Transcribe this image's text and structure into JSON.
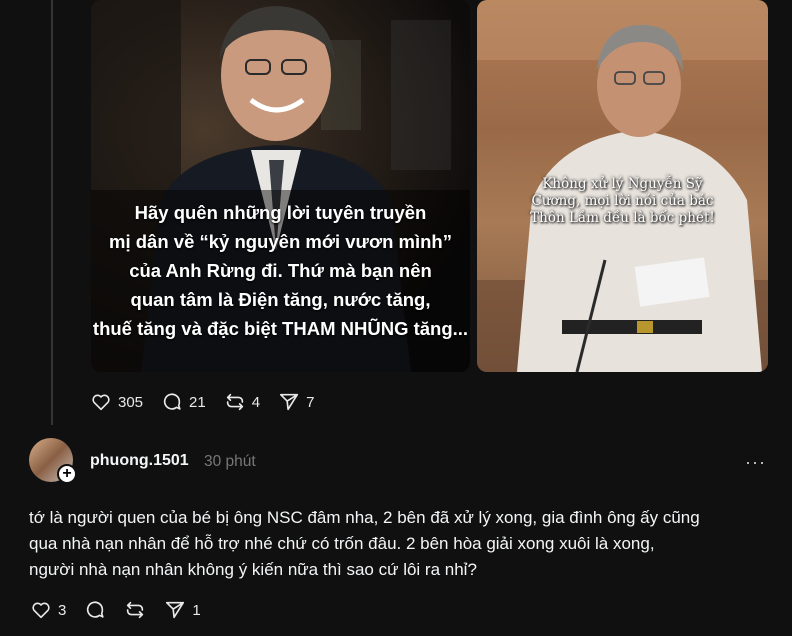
{
  "post": {
    "image1_caption_lines": [
      "Hãy quên những lời tuyên truyền",
      "mị dân về “kỷ nguyên mới vươn mình”",
      "của Anh Rừng đi. Thứ mà bạn nên",
      "quan tâm là  Điện tăng, nước tăng,",
      "thuế tăng và đặc biệt THAM NHŨNG tăng..."
    ],
    "image2_caption_lines": [
      "Không xử lý Nguyễn Sỹ",
      "Cương, mọi lời nói của bác",
      "Thôn Lầm đều là bốc phét!"
    ],
    "actions": {
      "likes": "305",
      "replies": "21",
      "reposts": "4",
      "shares": "7"
    }
  },
  "reply": {
    "username": "phuong.1501",
    "timestamp": "30 phút",
    "more": "···",
    "avatar_badge": "+",
    "body_lines": [
      "tớ là người quen của bé bị ông NSC đâm nha, 2 bên đã xử lý xong, gia đình ông ấy cũng",
      "qua nhà nạn nhân để hỗ trợ nhé chứ có trốn đâu. 2 bên hòa giải xong xuôi là xong,",
      "người nhà nạn nhân không ý kiến nữa thì sao cứ lôi ra nhỉ?"
    ],
    "actions": {
      "likes": "3",
      "shares": "1"
    }
  }
}
